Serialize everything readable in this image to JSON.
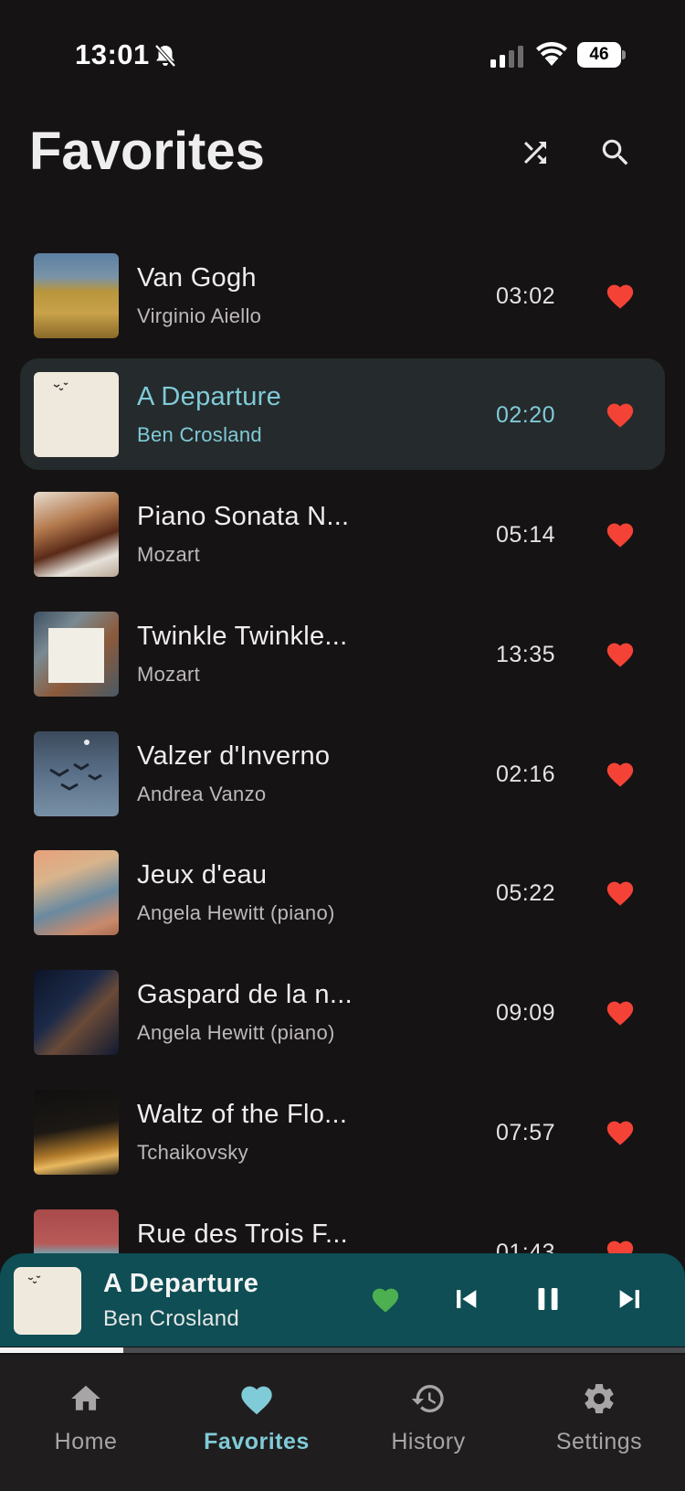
{
  "status_bar": {
    "time": "13:01",
    "battery": "46"
  },
  "header": {
    "title": "Favorites",
    "shuffle_icon": "shuffle-icon",
    "search_icon": "search-icon"
  },
  "colors": {
    "accent": "#7fcbd7",
    "heart": "#f44336",
    "now_playing_bg": "#0e4e54",
    "now_playing_heart": "#4caf50",
    "background": "#161314"
  },
  "tracks": [
    {
      "title": "Van Gogh",
      "artist": "Virginio Aiello",
      "duration": "03:02",
      "favorite": true
    },
    {
      "title": "A Departure",
      "artist": "Ben Crosland",
      "duration": "02:20",
      "favorite": true,
      "playing": true
    },
    {
      "title": "Piano Sonata N...",
      "artist": "Mozart",
      "duration": "05:14",
      "favorite": true
    },
    {
      "title": "Twinkle Twinkle...",
      "artist": "Mozart",
      "duration": "13:35",
      "favorite": true
    },
    {
      "title": "Valzer d'Inverno",
      "artist": "Andrea Vanzo",
      "duration": "02:16",
      "favorite": true
    },
    {
      "title": "Jeux d'eau",
      "artist": "Angela Hewitt (piano)",
      "duration": "05:22",
      "favorite": true
    },
    {
      "title": "Gaspard de la n...",
      "artist": "Angela Hewitt (piano)",
      "duration": "09:09",
      "favorite": true
    },
    {
      "title": "Waltz of the Flo...",
      "artist": "Tchaikovsky",
      "duration": "07:57",
      "favorite": true
    },
    {
      "title": "Rue des Trois F...",
      "artist": "",
      "duration": "01:43",
      "favorite": true
    }
  ],
  "now_playing": {
    "title": "A Departure",
    "artist": "Ben Crosland",
    "favorite": true,
    "progress": 0.18,
    "state": "playing"
  },
  "nav": {
    "items": [
      {
        "label": "Home",
        "icon": "home-icon"
      },
      {
        "label": "Favorites",
        "icon": "heart-icon",
        "active": true
      },
      {
        "label": "History",
        "icon": "history-icon"
      },
      {
        "label": "Settings",
        "icon": "gear-icon"
      }
    ]
  }
}
